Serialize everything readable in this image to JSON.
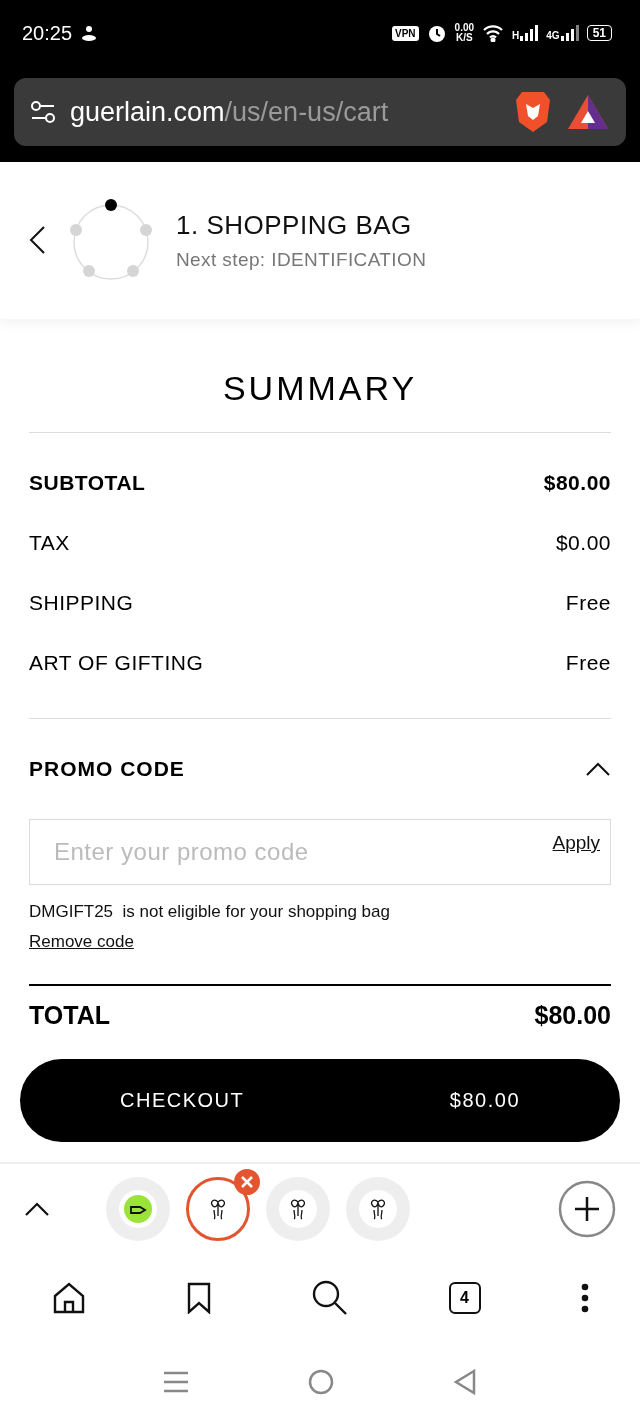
{
  "status_bar": {
    "time": "20:25",
    "vpn": "VPN",
    "speed": "0.00",
    "speed_unit": "K/S",
    "network_1": "H",
    "network_2": "4G",
    "battery": "51"
  },
  "address_bar": {
    "domain": "guerlain.com",
    "path": "/us/en-us/cart"
  },
  "checkout_header": {
    "title": "1. SHOPPING BAG",
    "subtitle": "Next step: IDENTIFICATION"
  },
  "summary": {
    "title": "SUMMARY",
    "rows": [
      {
        "label": "SUBTOTAL",
        "value": "$80.00",
        "bold": true
      },
      {
        "label": "TAX",
        "value": "$0.00",
        "bold": false
      },
      {
        "label": "SHIPPING",
        "value": "Free",
        "bold": false
      },
      {
        "label": "ART OF GIFTING",
        "value": "Free",
        "bold": false
      }
    ]
  },
  "promo": {
    "title": "PROMO CODE",
    "expanded": true,
    "placeholder": "Enter your promo code",
    "apply": "Apply",
    "code": "DMGIFT25",
    "message": "is not eligible for your shopping bag",
    "remove": "Remove code"
  },
  "total": {
    "label": "TOTAL",
    "value": "$80.00"
  },
  "checkout_button": {
    "label": "CHECKOUT",
    "amount": "$80.00"
  },
  "tab_strip": {
    "tabs": [
      {
        "kind": "tag",
        "selected": false
      },
      {
        "kind": "site",
        "selected": true
      },
      {
        "kind": "site",
        "selected": false
      },
      {
        "kind": "site",
        "selected": false
      }
    ]
  },
  "bottom_nav": {
    "tab_count": "4"
  }
}
